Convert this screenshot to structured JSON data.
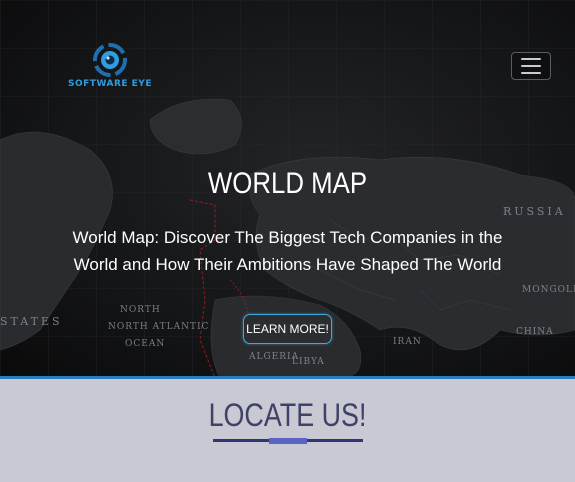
{
  "header": {
    "logo_text": "SOFTWARE EYE",
    "menu_icon": "hamburger-menu-icon"
  },
  "hero": {
    "title": "WORLD MAP",
    "subtitle": "World Map: Discover The Biggest Tech Companies in the World and How Their Ambitions Have Shaped The World",
    "button_label": "LEARN MORE!",
    "map_labels": {
      "russia": "RUSSIA",
      "china": "CHINA",
      "mongolia": "MONGOLIA",
      "iran": "IRAN",
      "libya": "LIBYA",
      "algeria": "ALGERIA",
      "north_atlantic": "NORTH ATLANTIC",
      "ocean": "OCEAN",
      "states": "STATES",
      "north": "NORTH"
    }
  },
  "locate": {
    "title": "LOCATE US!"
  },
  "colors": {
    "accent_blue": "#2b7cbf",
    "logo_blue": "#2f9de0",
    "locate_bg": "#c8c9d2",
    "locate_title": "#3e4268",
    "underline": "#2f3575",
    "underline_accent": "#5b63c4"
  }
}
